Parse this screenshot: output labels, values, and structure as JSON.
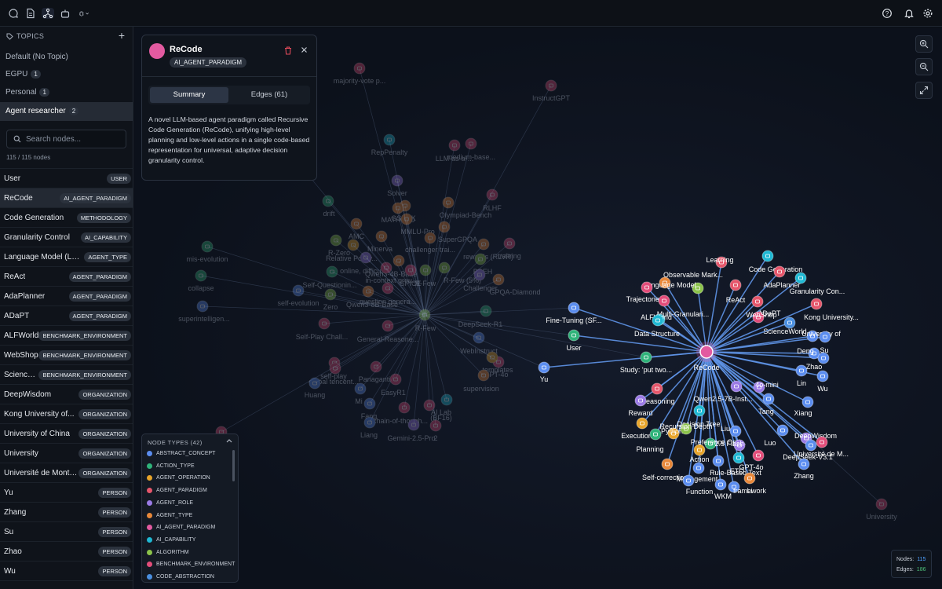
{
  "topbar": {
    "icons": [
      "chat-icon",
      "document-icon",
      "graph-icon",
      "robot-icon",
      "bug-icon",
      "help-icon",
      "bell-icon",
      "gear-icon"
    ]
  },
  "sidebar": {
    "topics_label": "TOPICS",
    "add_label": "+",
    "topics": [
      {
        "label": "Default (No Topic)",
        "count": ""
      },
      {
        "label": "EGPU",
        "count": "1"
      },
      {
        "label": "Personal",
        "count": "1"
      },
      {
        "label": "Agent researcher",
        "count": "2"
      }
    ],
    "search_placeholder": "Search nodes...",
    "count_text": "115 / 115 nodes",
    "nodes": [
      {
        "name": "User",
        "type": "USER"
      },
      {
        "name": "ReCode",
        "type": "AI_AGENT_PARADIGM"
      },
      {
        "name": "Code Generation",
        "type": "METHODOLOGY"
      },
      {
        "name": "Granularity Control",
        "type": "AI_CAPABILITY"
      },
      {
        "name": "Language Model (LLM)-...",
        "type": "AGENT_TYPE"
      },
      {
        "name": "ReAct",
        "type": "AGENT_PARADIGM"
      },
      {
        "name": "AdaPlanner",
        "type": "AGENT_PARADIGM"
      },
      {
        "name": "ADaPT",
        "type": "AGENT_PARADIGM"
      },
      {
        "name": "ALFWorld",
        "type": "BENCHMARK_ENVIRONMENT"
      },
      {
        "name": "WebShop",
        "type": "BENCHMARK_ENVIRONMENT"
      },
      {
        "name": "ScienceWorld",
        "type": "BENCHMARK_ENVIRONMENT"
      },
      {
        "name": "DeepWisdom",
        "type": "ORGANIZATION"
      },
      {
        "name": "Kong University of...",
        "type": "ORGANIZATION"
      },
      {
        "name": "University of China",
        "type": "ORGANIZATION"
      },
      {
        "name": "University",
        "type": "ORGANIZATION"
      },
      {
        "name": "Université de Montréal ...",
        "type": "ORGANIZATION"
      },
      {
        "name": "Yu",
        "type": "PERSON"
      },
      {
        "name": "Zhang",
        "type": "PERSON"
      },
      {
        "name": "Su",
        "type": "PERSON"
      },
      {
        "name": "Zhao",
        "type": "PERSON"
      },
      {
        "name": "Wu",
        "type": "PERSON"
      },
      {
        "name": "",
        "type": ""
      }
    ]
  },
  "card": {
    "title": "ReCode",
    "type": "AI_AGENT_PARADIGM",
    "tab_summary": "Summary",
    "tab_edges": "Edges (61)",
    "description": "A novel LLM-based agent paradigm called Recursive Code Generation (ReCode), unifying high-level planning and low-level actions in a single code-based representation for universal, adaptive decision granularity control."
  },
  "legend": {
    "title": "NODE TYPES (42)",
    "items": [
      {
        "label": "ABSTRACT_CONCEPT",
        "color": "#5b8def"
      },
      {
        "label": "ACTION_TYPE",
        "color": "#2fb37a"
      },
      {
        "label": "AGENT_OPERATION",
        "color": "#e7a42a"
      },
      {
        "label": "AGENT_PARADIGM",
        "color": "#e5566b"
      },
      {
        "label": "AGENT_ROLE",
        "color": "#9b7be6"
      },
      {
        "label": "AGENT_TYPE",
        "color": "#e8883a"
      },
      {
        "label": "AI_AGENT_PARADIGM",
        "color": "#e25aa0"
      },
      {
        "label": "AI_CAPABILITY",
        "color": "#1fb8d3"
      },
      {
        "label": "ALGORITHM",
        "color": "#8bc34a"
      },
      {
        "label": "BENCHMARK_ENVIRONMENT",
        "color": "#e34d7a"
      },
      {
        "label": "CODE_ABSTRACTION",
        "color": "#4a8fe0"
      }
    ]
  },
  "stats": {
    "nodes_label": "Nodes:",
    "nodes_value": "115",
    "edges_label": "Edges:",
    "edges_value": "186"
  },
  "graph": {
    "hub": {
      "label": "ReCode",
      "color": "#e25aa0"
    },
    "active_nodes": [
      {
        "label": "Learning",
        "color": "#e5566b"
      },
      {
        "label": "Code Generation",
        "color": "#1fb8d3"
      },
      {
        "label": "Observable Mark...",
        "color": "#8bc34a"
      },
      {
        "label": "AdaPlanner",
        "color": "#e5566b"
      },
      {
        "label": "Granularity Con...",
        "color": "#1fb8d3"
      },
      {
        "label": "Language Model",
        "color": "#e8883a"
      },
      {
        "label": "Trajectories",
        "color": "#e34d7a"
      },
      {
        "label": "ReAct",
        "color": "#e5566b"
      },
      {
        "label": "Multi-Granulari...",
        "color": "#e34d7a"
      },
      {
        "label": "ALFWorld",
        "color": "#1fb8d3"
      },
      {
        "label": "ADaPT",
        "color": "#e5566b"
      },
      {
        "label": "Kong University...",
        "color": "#e5566b"
      },
      {
        "label": "WebShop",
        "color": "#e34d7a"
      },
      {
        "label": "Data Structure",
        "color": "#1fb8d3"
      },
      {
        "label": "ScienceWorld",
        "color": "#4a8fe0"
      },
      {
        "label": "University of",
        "color": "#5b8def"
      },
      {
        "label": "Su",
        "color": "#5b8def"
      },
      {
        "label": "Deng",
        "color": "#5b8def"
      },
      {
        "label": "Fine-Tuning (SF...",
        "color": "#5b8def"
      },
      {
        "label": "User",
        "color": "#2fb37a"
      },
      {
        "label": "Study: 'put two...",
        "color": "#2fb37a"
      },
      {
        "label": "Yu",
        "color": "#5b8def"
      },
      {
        "label": "Zhao",
        "color": "#5b8def"
      },
      {
        "label": "4o-mini",
        "color": "#9b7be6"
      },
      {
        "label": "Lin",
        "color": "#5b8def"
      },
      {
        "label": "Wu",
        "color": "#5b8def"
      },
      {
        "label": "Reasoning",
        "color": "#e5566b"
      },
      {
        "label": "Qwen2.5-7B-Inst...",
        "color": "#9b7be6"
      },
      {
        "label": "Tang",
        "color": "#5b8def"
      },
      {
        "label": "Xiang",
        "color": "#5b8def"
      },
      {
        "label": "Reward",
        "color": "#9b7be6"
      },
      {
        "label": "Decision Tree",
        "color": "#1fb8d3"
      },
      {
        "label": "Execution",
        "color": "#e7a42a"
      },
      {
        "label": "Python",
        "color": "#e7a42a"
      },
      {
        "label": "Planning",
        "color": "#2fb37a"
      },
      {
        "label": "Recursion Depth",
        "color": "#8bc34a"
      },
      {
        "label": "Preference Opti...",
        "color": "#2fb37a"
      },
      {
        "label": "Liu",
        "color": "#5b8def"
      },
      {
        "label": "Luo",
        "color": "#5b8def"
      },
      {
        "label": "DeepWisdom",
        "color": "#9b7be6"
      },
      {
        "label": "2.5 Flash",
        "color": "#9b7be6"
      },
      {
        "label": "DeepSeek-V3.1",
        "color": "#5b8def"
      },
      {
        "label": "Université de M...",
        "color": "#e34d7a"
      },
      {
        "label": "Action",
        "color": "#e7a42a"
      },
      {
        "label": "Self-correction",
        "color": "#e8883a"
      },
      {
        "label": "Rule-Based Text",
        "color": "#5b8def"
      },
      {
        "label": "Management",
        "color": "#5b8def"
      },
      {
        "label": "GPT-4o",
        "color": "#e34d7a"
      },
      {
        "label": "ETO",
        "color": "#1fb8d3"
      },
      {
        "label": "Li",
        "color": "#e8883a"
      },
      {
        "label": "Zhang",
        "color": "#5b8def"
      },
      {
        "label": "Function",
        "color": "#5b8def"
      },
      {
        "label": "WKM",
        "color": "#5b8def"
      },
      {
        "label": "framework",
        "color": "#5b8def"
      }
    ],
    "faded_nodes": [
      {
        "label": "majority-vote p...",
        "color": "#e34d7a"
      },
      {
        "label": "InstructGPT",
        "color": "#e34d7a"
      },
      {
        "label": "RepPenalty",
        "color": "#1fb8d3"
      },
      {
        "label": "LLM-as-a-...",
        "color": "#e34d7a"
      },
      {
        "label": "medium-base...",
        "color": "#e34d7a"
      },
      {
        "label": "verification",
        "color": "#9b7be6"
      },
      {
        "label": "Solver",
        "color": "#9b7be6"
      },
      {
        "label": "RLHF",
        "color": "#e34d7a"
      },
      {
        "label": "drift",
        "color": "#2fb37a"
      },
      {
        "label": "GSM8K",
        "color": "#e8883a"
      },
      {
        "label": "Olympiad-Bench",
        "color": "#e8883a"
      },
      {
        "label": "AMC",
        "color": "#e8883a"
      },
      {
        "label": "MATH-500",
        "color": "#e8883a"
      },
      {
        "label": "MMLU-Pro",
        "color": "#e8883a"
      },
      {
        "label": "SuperGPQA",
        "color": "#e8883a"
      },
      {
        "label": "R-Zero",
        "color": "#8bc34a"
      },
      {
        "label": "rewards (RLVR)",
        "color": "#e8883a"
      },
      {
        "label": "mis-evolution",
        "color": "#2fb37a"
      },
      {
        "label": "Minerva",
        "color": "#e8883a"
      },
      {
        "label": "challenger trai...",
        "color": "#e8883a"
      },
      {
        "label": "training",
        "color": "#e34d7a"
      },
      {
        "label": "Relative Policy...",
        "color": "#e7a42a"
      },
      {
        "label": "online, difficu...",
        "color": "#9b7be6"
      },
      {
        "label": "Qwen3-4B-Base",
        "color": "#e8883a"
      },
      {
        "label": "collapse",
        "color": "#2fb37a"
      },
      {
        "label": "SPICE",
        "color": "#e34d7a"
      },
      {
        "label": "in-context grou...",
        "color": "#e34d7a"
      },
      {
        "label": "BBEH",
        "color": "#8bc34a"
      },
      {
        "label": "self-evolution",
        "color": "#5b8def"
      },
      {
        "label": "Self-Questionin...",
        "color": "#2fb37a"
      },
      {
        "label": "R-Few",
        "color": "#8bc34a"
      },
      {
        "label": "R-Few (5%)",
        "color": "#8bc34a"
      },
      {
        "label": "Challenger",
        "color": "#9b7be6"
      },
      {
        "label": "GPQA-Diamond",
        "color": "#e8883a"
      },
      {
        "label": "Zero",
        "color": "#8bc34a"
      },
      {
        "label": "question genera...",
        "color": "#e34d7a"
      },
      {
        "label": "superintelligen...",
        "color": "#5b8def"
      },
      {
        "label": "Qwen3-8B-Base",
        "color": "#e8883a"
      },
      {
        "label": "R-Few",
        "color": "#8bc34a"
      },
      {
        "label": "DeepSeek-R1",
        "color": "#2fb37a"
      },
      {
        "label": "Self-Play Chall...",
        "color": "#e34d7a"
      },
      {
        "label": "General-Reasone...",
        "color": "#e34d7a"
      },
      {
        "label": "WebInstruct",
        "color": "#5b8def"
      },
      {
        "label": "GPT-4o",
        "color": "#e34d7a"
      },
      {
        "label": "self-play",
        "color": "#e34d7a"
      },
      {
        "label": "global tencent...",
        "color": "#e34d7a"
      },
      {
        "label": "Panaganti",
        "color": "#e34d7a"
      },
      {
        "label": "templates",
        "color": "#e7a42a"
      },
      {
        "label": "Huang",
        "color": "#5b8def"
      },
      {
        "label": "EasyR1",
        "color": "#e34d7a"
      },
      {
        "label": "supervision",
        "color": "#e8883a"
      },
      {
        "label": "Mi",
        "color": "#5b8def"
      },
      {
        "label": "(BF16)",
        "color": "#e34d7a"
      },
      {
        "label": "Fang",
        "color": "#5b8def"
      },
      {
        "label": "chain-of-though...",
        "color": "#e34d7a"
      },
      {
        "label": "AI Lab",
        "color": "#1fb8d3"
      },
      {
        "label": "Liang",
        "color": "#5b8def"
      },
      {
        "label": "Gemini-2.5-Pro",
        "color": "#9b7be6"
      },
      {
        "label": "2",
        "color": "#e34d7a"
      },
      {
        "label": "University",
        "color": "#e34d7a"
      },
      {
        "label": "",
        "color": "#e34d7a"
      }
    ]
  }
}
